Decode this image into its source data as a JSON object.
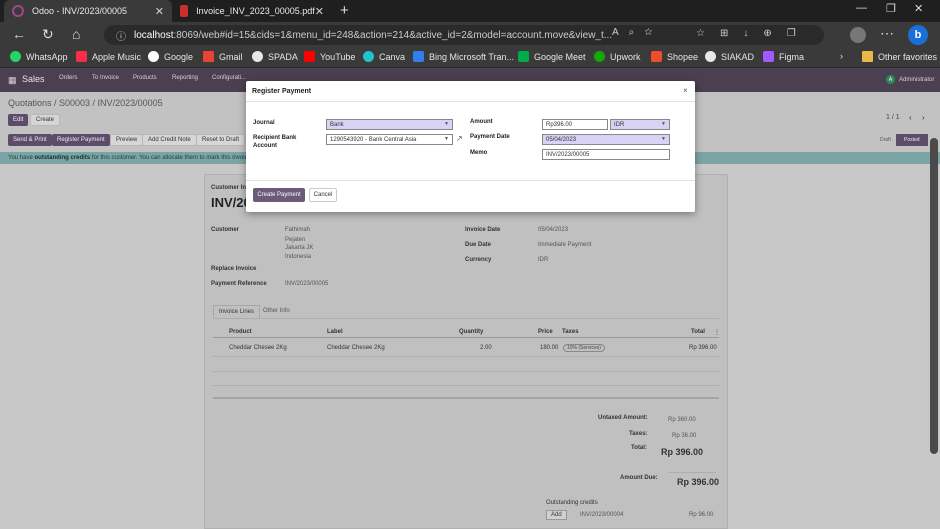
{
  "browser": {
    "tabs": [
      {
        "title": "Odoo - INV/2023/00005",
        "active": true
      },
      {
        "title": "Invoice_INV_2023_00005.pdf",
        "active": false
      }
    ],
    "url_host": "localhost",
    "url_rest": ":8069/web#id=15&cids=1&menu_id=248&action=214&active_id=2&model=account.move&view_t...",
    "bookmarks": [
      "WhatsApp",
      "Apple Music",
      "Google",
      "Gmail",
      "SPADA",
      "YouTube",
      "Canva",
      "Bing Microsoft Tran...",
      "Google Meet",
      "Upwork",
      "Shopee",
      "SIAKAD",
      "Figma"
    ],
    "other_favorites": "Other favorites"
  },
  "odoo": {
    "app_name": "Sales",
    "menu": [
      "Orders",
      "To Invoice",
      "Products",
      "Reporting",
      "Configurati..."
    ],
    "user": "Administrator",
    "user_initial": "A",
    "breadcrumb": "Quotations / S00003 / INV/2023/00005",
    "edit_label": "Edit",
    "create_label": "Create",
    "pager": "1 / 1",
    "actions": [
      "Send & Print",
      "Register Payment",
      "Preview",
      "Add Credit Note",
      "Reset to Draft"
    ],
    "statuses": [
      "Draft",
      "Posted"
    ],
    "alert_prefix": "You have ",
    "alert_bold": "outstanding credits",
    "alert_suffix": " for this customer. You can allocate them to mark this invoic"
  },
  "invoice": {
    "type_label": "Customer In",
    "number_partial": "INV/202",
    "customer_label": "Customer",
    "customer_lines": [
      "Fathimah",
      "Pejaten",
      "Jakarta JK",
      "Indonesia"
    ],
    "replace_invoice_label": "Replace Invoice",
    "payment_reference_label": "Payment Reference",
    "payment_reference": "INV/2023/00005",
    "invoice_date_label": "Invoice Date",
    "invoice_date": "05/04/2023",
    "due_date_label": "Due Date",
    "due_date": "Immediate Payment",
    "currency_label": "Currency",
    "currency": "IDR",
    "tabs": [
      "Invoice Lines",
      "Other Info"
    ],
    "columns": [
      "Product",
      "Label",
      "Quantity",
      "Price",
      "Taxes",
      "Total"
    ],
    "lines": [
      {
        "product": "Cheddar Chesee 2Kg",
        "label": "Cheddar Chesee 2Kg",
        "quantity": "2.00",
        "price": "180.00",
        "taxes": "10% (Services)",
        "total": "Rp 396.00"
      }
    ],
    "untaxed_label": "Untaxed Amount:",
    "untaxed": "Rp 360.00",
    "taxes_label": "Taxes:",
    "taxes": "Rp 36.00",
    "total_label": "Total:",
    "total": "Rp 396.00",
    "amount_due_label": "Amount Due:",
    "amount_due": "Rp 396.00",
    "outstanding_label": "Outstanding credits",
    "outstanding_add": "Add",
    "outstanding_ref": "INV/2023/00004",
    "outstanding_amount": "Rp 96.00"
  },
  "modal": {
    "title": "Register Payment",
    "close": "×",
    "journal_label": "Journal",
    "journal": "Bank",
    "recipient_label": "Recipient Bank Account",
    "recipient": "1290543920 - Bank Central Asia",
    "amount_label": "Amount",
    "amount": "Rp396.00",
    "currency": "IDR",
    "payment_date_label": "Payment Date",
    "payment_date": "05/04/2023",
    "memo_label": "Memo",
    "memo": "INV/2023/00005",
    "create_button": "Create Payment",
    "cancel_button": "Cancel"
  }
}
